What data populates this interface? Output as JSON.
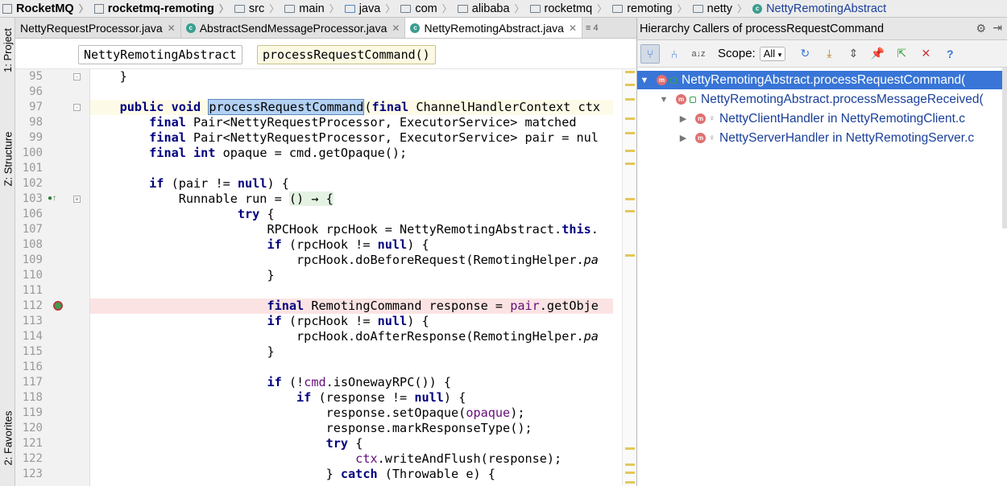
{
  "breadcrumb": [
    {
      "label": "RocketMQ",
      "icon": "module-icon",
      "bold": true
    },
    {
      "label": "rocketmq-remoting",
      "icon": "module-icon",
      "bold": true
    },
    {
      "label": "src",
      "icon": "folder-icon"
    },
    {
      "label": "main",
      "icon": "folder-icon"
    },
    {
      "label": "java",
      "icon": "source-folder-icon"
    },
    {
      "label": "com",
      "icon": "package-icon"
    },
    {
      "label": "alibaba",
      "icon": "package-icon"
    },
    {
      "label": "rocketmq",
      "icon": "package-icon"
    },
    {
      "label": "remoting",
      "icon": "package-icon"
    },
    {
      "label": "netty",
      "icon": "package-icon"
    },
    {
      "label": "NettyRemotingAbstract",
      "icon": "class-icon"
    }
  ],
  "left_strip": {
    "project": "1: Project",
    "structure": "Z: Structure",
    "favorites": "2: Favorites"
  },
  "tabs": [
    {
      "label": "NettyRequestProcessor.java",
      "active": false
    },
    {
      "label": "AbstractSendMessageProcessor.java",
      "active": false
    },
    {
      "label": "NettyRemotingAbstract.java",
      "active": true
    }
  ],
  "tab_more": "≡ 4",
  "editor_breadcrumb": {
    "class": "NettyRemotingAbstract",
    "method": "processRequestCommand()"
  },
  "editor": {
    "lines": [
      {
        "n": "95",
        "code": "    }"
      },
      {
        "n": "96",
        "code": ""
      },
      {
        "n": "97",
        "code": "    public void processRequestCommand(final ChannelHandlerContext ctx"
      },
      {
        "n": "98",
        "code": "        final Pair<NettyRequestProcessor, ExecutorService> matched"
      },
      {
        "n": "99",
        "code": "        final Pair<NettyRequestProcessor, ExecutorService> pair = nul"
      },
      {
        "n": "100",
        "code": "        final int opaque = cmd.getOpaque();"
      },
      {
        "n": "101",
        "code": ""
      },
      {
        "n": "102",
        "code": "        if (pair != null) {"
      },
      {
        "n": "103",
        "code": "            Runnable run = () → {"
      },
      {
        "n": "106",
        "code": "                    try {"
      },
      {
        "n": "107",
        "code": "                        RPCHook rpcHook = NettyRemotingAbstract.this."
      },
      {
        "n": "108",
        "code": "                        if (rpcHook != null) {"
      },
      {
        "n": "109",
        "code": "                            rpcHook.doBeforeRequest(RemotingHelper.pa"
      },
      {
        "n": "110",
        "code": "                        }"
      },
      {
        "n": "111",
        "code": ""
      },
      {
        "n": "112",
        "code": "                        final RemotingCommand response = pair.getObje"
      },
      {
        "n": "113",
        "code": "                        if (rpcHook != null) {"
      },
      {
        "n": "114",
        "code": "                            rpcHook.doAfterResponse(RemotingHelper.pa"
      },
      {
        "n": "115",
        "code": "                        }"
      },
      {
        "n": "116",
        "code": ""
      },
      {
        "n": "117",
        "code": "                        if (!cmd.isOnewayRPC()) {"
      },
      {
        "n": "118",
        "code": "                            if (response != null) {"
      },
      {
        "n": "119",
        "code": "                                response.setOpaque(opaque);"
      },
      {
        "n": "120",
        "code": "                                response.markResponseType();"
      },
      {
        "n": "121",
        "code": "                                try {"
      },
      {
        "n": "122",
        "code": "                                    ctx.writeAndFlush(response);"
      },
      {
        "n": "123",
        "code": "                                } catch (Throwable e) {"
      }
    ]
  },
  "hierarchy": {
    "title": "Hierarchy Callers of processRequestCommand",
    "scope_label": "Scope:",
    "scope_value": "All",
    "nodes": [
      {
        "label": "NettyRemotingAbstract.processRequestCommand(",
        "level": 0,
        "expanded": true,
        "selected": true
      },
      {
        "label": "NettyRemotingAbstract.processMessageReceived(",
        "level": 1,
        "expanded": true,
        "selected": false
      },
      {
        "label": "NettyClientHandler in NettyRemotingClient.c",
        "level": 2,
        "expanded": false,
        "selected": false
      },
      {
        "label": "NettyServerHandler in NettyRemotingServer.c",
        "level": 2,
        "expanded": false,
        "selected": false
      }
    ]
  },
  "colors": {
    "keyword": "#00007f",
    "selection": "#3875d7",
    "breakpoint_line": "#fbe3e3",
    "caret_line": "#fdfbe7"
  }
}
